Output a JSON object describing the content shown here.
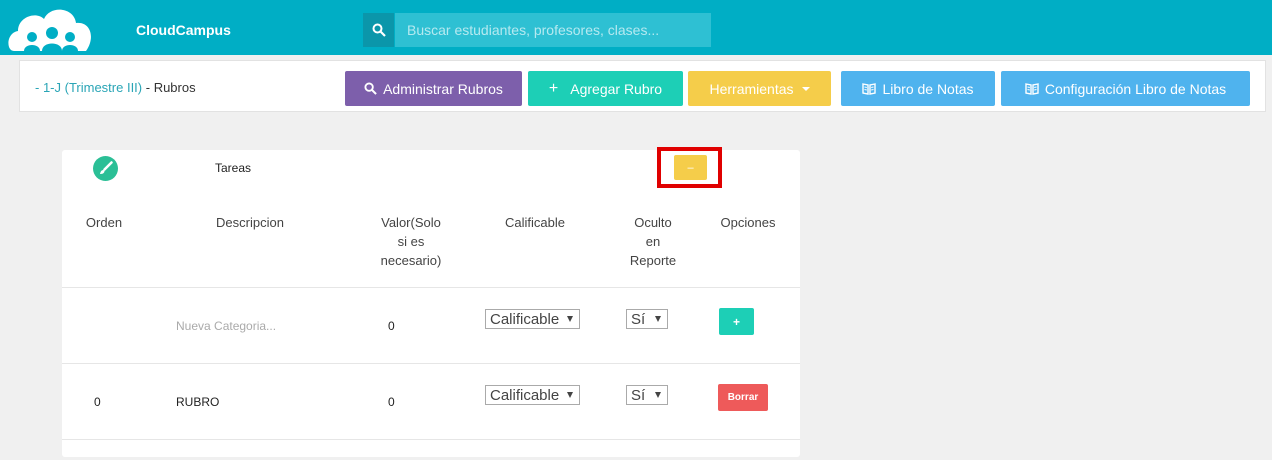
{
  "app": {
    "brand": "CloudCampus"
  },
  "search": {
    "placeholder": "Buscar estudiantes, profesores, clases..."
  },
  "breadcrumb": {
    "link": "- 1-J (Trimestre III)",
    "separator": " - ",
    "current": "Rubros"
  },
  "toolbar": {
    "manage_rubrics": "Administrar Rubros",
    "add_rubric": "Agregar Rubro",
    "tools": "Herramientas",
    "gradebook": "Libro de Notas",
    "gradebook_config": "Configuración Libro de Notas"
  },
  "category": {
    "title": "Tareas",
    "collapse_label": "–"
  },
  "table": {
    "headers": {
      "orden": "Orden",
      "descripcion": "Descripcion",
      "valor_1": "Valor(Solo",
      "valor_2": "si es",
      "valor_3": "necesario)",
      "calificable": "Calificable",
      "oculto_1": "Oculto",
      "oculto_2": "en",
      "oculto_3": "Reporte",
      "opciones": "Opciones"
    },
    "new_row": {
      "description_placeholder": "Nueva Categoria...",
      "value": "0",
      "calificable": "Calificable",
      "oculto": "Sí",
      "add_label": "+"
    },
    "rows": [
      {
        "orden": "0",
        "descripcion": "RUBRO",
        "valor": "0",
        "calificable": "Calificable",
        "oculto": "Sí",
        "delete_label": "Borrar"
      }
    ]
  },
  "colors": {
    "topbar": "#00aec5",
    "purple": "#7d5fab",
    "teal": "#1dcfb6",
    "yellow": "#f5cd4a",
    "blue": "#4fb3ee",
    "red": "#ee5a5a",
    "highlight": "#e00000"
  },
  "icons": {
    "logo": "cloud-people-logo",
    "search": "search-icon",
    "book": "book-icon",
    "brush": "brush-icon"
  }
}
